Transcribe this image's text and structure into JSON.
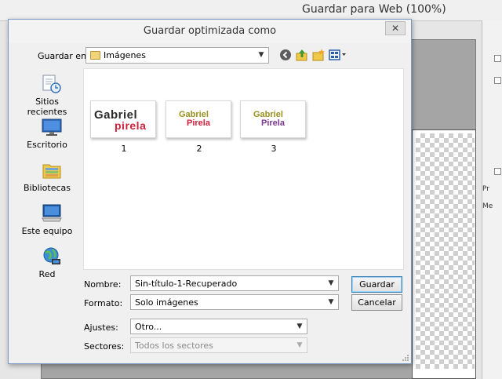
{
  "app": {
    "title": "Guardar para Web (100%)"
  },
  "right_panel": {
    "labels": [
      "Pr",
      "Me"
    ]
  },
  "dialog": {
    "title": "Guardar optimizada como",
    "close_glyph": "✕",
    "save_in_label": "Guardar en:",
    "save_in_value": "Imágenes",
    "places": [
      {
        "label": "Sitios recientes",
        "icon": "recent-places-icon"
      },
      {
        "label": "Escritorio",
        "icon": "desktop-icon"
      },
      {
        "label": "Bibliotecas",
        "icon": "libraries-icon"
      },
      {
        "label": "Este equipo",
        "icon": "computer-icon"
      },
      {
        "label": "Red",
        "icon": "network-icon"
      }
    ],
    "files": [
      {
        "label": "1",
        "logo_top": "Gabriel",
        "logo_bottom": "pirela"
      },
      {
        "label": "2",
        "logo_top": "Gabriel",
        "logo_bottom": "Pirela"
      },
      {
        "label": "3",
        "logo_top": "Gabriel",
        "logo_bottom": "Pirela"
      }
    ],
    "name_label": "Nombre:",
    "name_value": "Sin-título-1-Recuperado",
    "format_label": "Formato:",
    "format_value": "Solo imágenes",
    "settings_label": "Ajustes:",
    "settings_value": "Otro...",
    "slices_label": "Sectores:",
    "slices_value": "Todos los sectores",
    "save_button": "Guardar",
    "cancel_button": "Cancelar"
  },
  "colors": {
    "logo_dark": "#2b2b2b",
    "logo_red": "#d0213b",
    "logo_olive": "#9a8f1f",
    "logo_purple": "#7a3a8f"
  }
}
